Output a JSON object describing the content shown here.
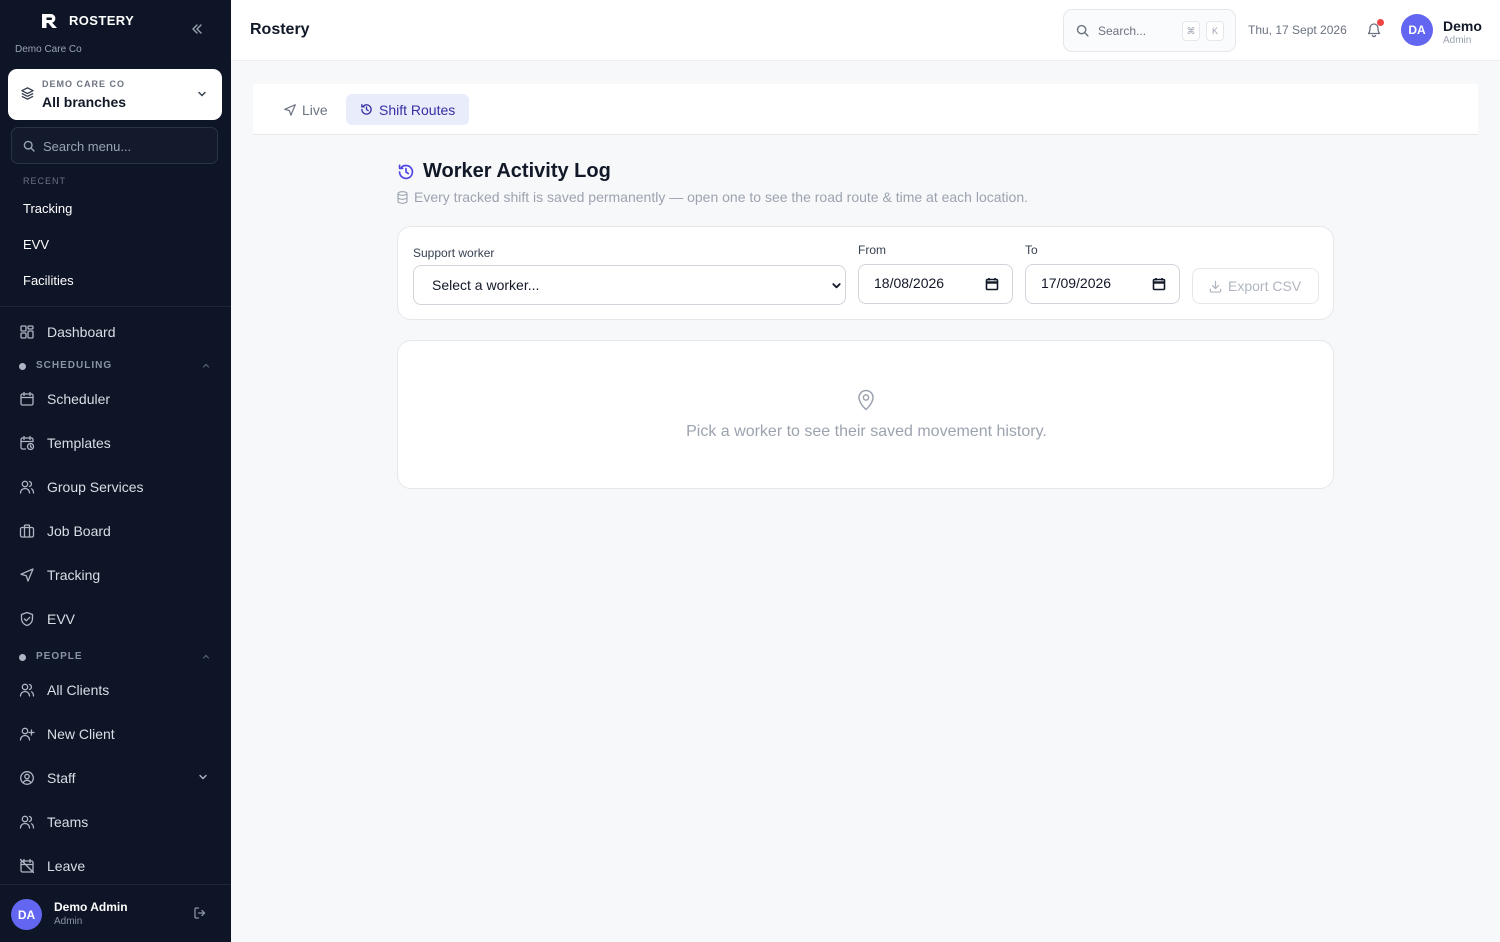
{
  "sidebar": {
    "brand": "ROSTERY",
    "org_name": "Demo Care Co",
    "org_selector": {
      "caption": "DEMO CARE CO",
      "value": "All branches"
    },
    "search_placeholder": "Search menu...",
    "recent_label": "RECENT",
    "recent": [
      "Tracking",
      "EVV",
      "Facilities"
    ],
    "dashboard": "Dashboard",
    "scheduling_label": "SCHEDULING",
    "scheduling": [
      "Scheduler",
      "Templates",
      "Group Services",
      "Job Board",
      "Tracking",
      "EVV"
    ],
    "people_label": "PEOPLE",
    "people": [
      "All Clients",
      "New Client",
      "Staff",
      "Teams",
      "Leave"
    ],
    "user": {
      "initials": "DA",
      "name": "Demo Admin",
      "role": "Admin"
    }
  },
  "topbar": {
    "title": "Rostery",
    "search_placeholder": "Search...",
    "kbd_cmd": "⌘",
    "kbd_key": "K",
    "date": "Thu, 17 Sept 2026",
    "user": {
      "initials": "DA",
      "name": "Demo",
      "role": "Admin"
    }
  },
  "tabs": {
    "live": "Live",
    "routes": "Shift Routes"
  },
  "main": {
    "title": "Worker Activity Log",
    "subtitle": "Every tracked shift is saved permanently — open one to see the road route & time at each location.",
    "filters": {
      "worker_label": "Support worker",
      "worker_value": "Select a worker...",
      "from_label": "From",
      "from_value": "18/08/2026",
      "to_label": "To",
      "to_value": "17/09/2026",
      "export_label": "Export CSV"
    },
    "empty_message": "Pick a worker to see their saved movement history."
  },
  "colors": {
    "sidebar_bg": "#0e1526",
    "accent": "#4f46e5",
    "avatar": "#6366f1",
    "active_tab_bg": "#e8ecfb"
  }
}
